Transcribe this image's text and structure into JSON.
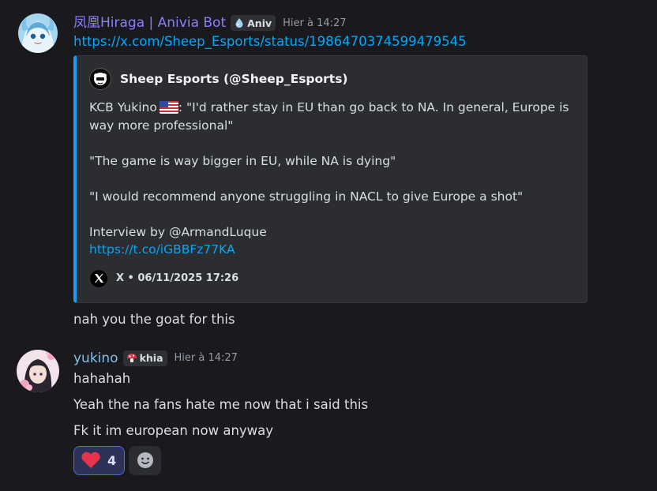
{
  "messages": [
    {
      "author": "凤凰Hiraga | Anivia Bot",
      "author_color": "#8b7ff9",
      "tag": "Aniv",
      "timestamp": "Hier à 14:27",
      "link": "https://x.com/Sheep_Esports/status/1986470374599479545",
      "embed": {
        "author": "Sheep Esports (@Sheep_Esports)",
        "line1_pre": "KCB Yukino",
        "line1_post": ": \"I'd rather stay in EU than go back to NA. In general, Europe is way more professional\"",
        "line2": "\"The game is way bigger in EU, while NA is dying\"",
        "line3": "\"I would recommend anyone struggling in NACL to give Europe a shot\"",
        "line4": "Interview by @ArmandLuque",
        "short_link": "https://t.co/iGBBFz77KA",
        "footer": "X • 06/11/2025 17:26",
        "accent_color": "#1d9bf0"
      },
      "followup": "nah you the goat for this"
    },
    {
      "author": "yukino",
      "author_color": "#7fc1ea",
      "tag": "khia",
      "timestamp": "Hier à 14:27",
      "lines": [
        "hahahah",
        "Yeah the na fans hate me now that i said this",
        "Fk it im european now anyway"
      ],
      "reactions": [
        {
          "emoji": "heart",
          "count": "4"
        }
      ]
    }
  ]
}
